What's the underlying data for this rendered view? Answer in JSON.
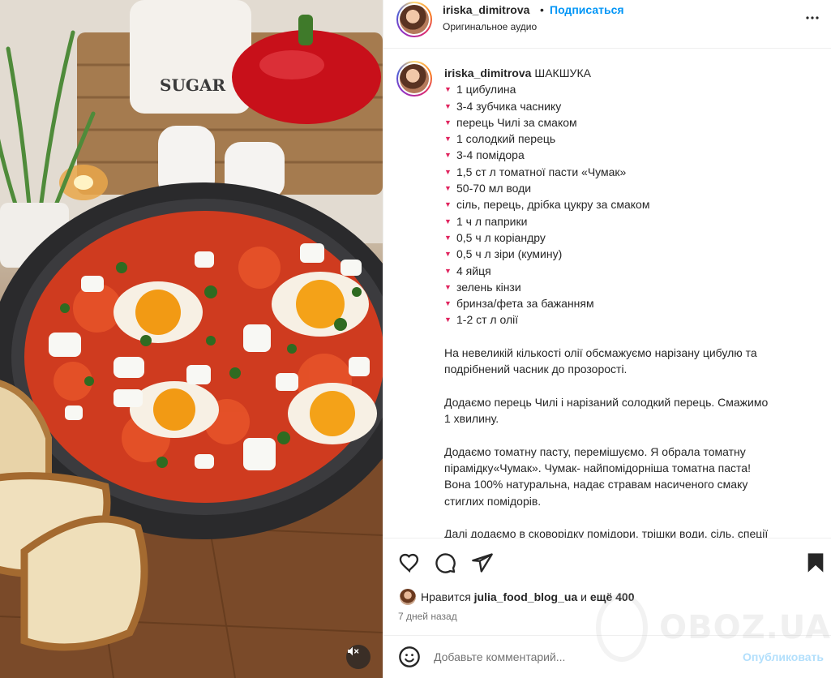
{
  "post": {
    "username": "iriska_dimitrova",
    "separator": "•",
    "follow_label": "Подписаться",
    "audio_label": "Оригинальное аудио"
  },
  "caption": {
    "username": "iriska_dimitrova",
    "title": "ШАКШУКА",
    "ingredients": [
      "1 цибулина",
      "3-4 зубчика часнику",
      "перець Чилі за смаком",
      "1 солодкий перець",
      "3-4 помідора",
      "1,5 ст л томатної пасти «Чумак»",
      "50-70 мл води",
      "сіль, перець, дрібка цукру за смаком",
      "1 ч л паприки",
      "0,5 ч л коріандру",
      "0,5 ч л зіри (кумину)",
      "4 яйця",
      "зелень кінзи",
      "бринза/фета за бажанням",
      "1-2 ст л олії"
    ],
    "paragraphs": [
      "На невеликій кількості олії обсмажуємо нарізану цибулю та\nподрібнений часник до прозорості.",
      "Додаємо перець Чилі і нарізаний солодкий перець. Смажимо\n1 хвилину.",
      "Додаємо томатну пасту, перемішуємо. Я обрала томатну\nпірамідку«Чумак». Чумак- найпомідорніша томатна паста!\nВона 100% натуральна, надає стравам насиченого смаку\nстиглих помідорів.",
      "Далі додаємо в сковорідку помідори, трішки води, сіль, спеції"
    ]
  },
  "likes": {
    "prefix": "Нравится",
    "user": "julia_food_blog_ua",
    "conj": "и",
    "others": "ещё 400"
  },
  "time_ago": "7 дней назад",
  "comment": {
    "placeholder": "Добавьте комментарий...",
    "publish_label": "Опубликовать"
  },
  "media": {
    "jar_label": "SUGAR"
  },
  "watermark": "OBOZ.UA",
  "colors": {
    "accent_blue": "#0095f6",
    "publish_disabled": "#b2dffc",
    "heart_bullet": "#e0245e"
  }
}
